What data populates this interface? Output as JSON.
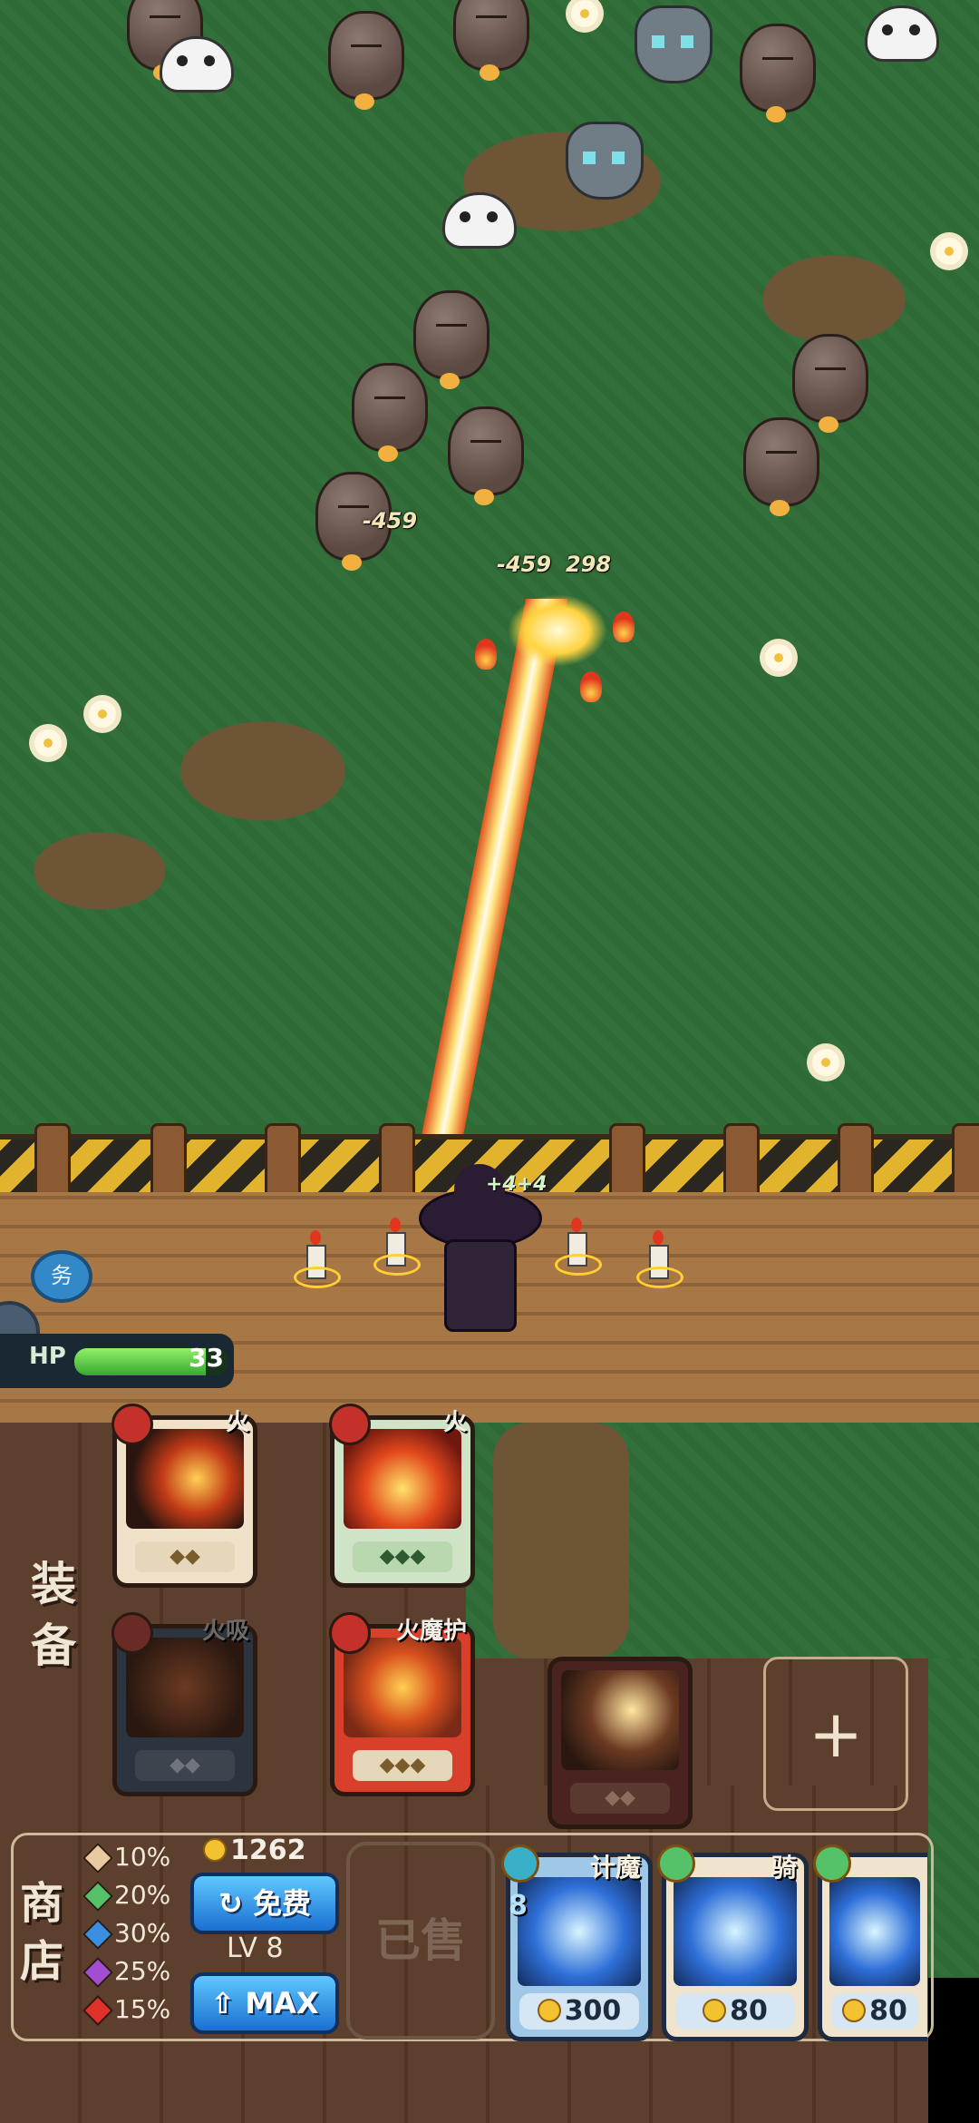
{
  "battlefield": {
    "damage_numbers": [
      "-459",
      "-459",
      "298"
    ],
    "buff_text": "+4+4"
  },
  "hud": {
    "hp_label": "HP",
    "hp_value": "33",
    "hp_fill_fraction": 0.85,
    "skill_badge": "务"
  },
  "equipment": {
    "title": "装备",
    "cards": [
      {
        "name": "火",
        "stars": "◆◆",
        "tier": 2
      },
      {
        "name": "火",
        "stars": "◆◆◆",
        "tier": 3
      },
      {
        "name": "火吸",
        "stars": "◆◆",
        "tier": 2
      },
      {
        "name": "火魔护",
        "stars": "◆◆◆",
        "tier": 3
      },
      {
        "name": "",
        "stars": "◆◆",
        "tier": 2
      }
    ],
    "empty_slot_label": "+"
  },
  "shop": {
    "title": "商店",
    "rates": [
      {
        "value": "10%",
        "color": "#e8c9a0"
      },
      {
        "value": "20%",
        "color": "#55c26a"
      },
      {
        "value": "30%",
        "color": "#3a8fe0"
      },
      {
        "value": "25%",
        "color": "#a24ed0"
      },
      {
        "value": "15%",
        "color": "#e0302a"
      }
    ],
    "coins": "1262",
    "refresh_label": "免费",
    "level_label": "LV 8",
    "upgrade_label": "MAX",
    "sold_label": "已售",
    "items": [
      {
        "name": "计魔",
        "level": "8",
        "price": "300"
      },
      {
        "name": "骑",
        "level": "",
        "price": "80"
      },
      {
        "name": "",
        "level": "",
        "price": "80"
      }
    ]
  }
}
